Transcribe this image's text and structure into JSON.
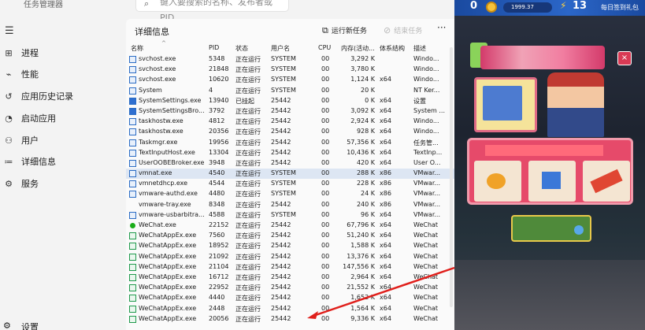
{
  "window": {
    "title": "任务管理器"
  },
  "search": {
    "placeholder": "键入要搜索的名称、发布者或 PID"
  },
  "sidebar": {
    "items": [
      {
        "label": "进程",
        "icon": "grid-icon"
      },
      {
        "label": "性能",
        "icon": "chart-icon"
      },
      {
        "label": "应用历史记录",
        "icon": "history-icon"
      },
      {
        "label": "启动应用",
        "icon": "gauge-icon"
      },
      {
        "label": "用户",
        "icon": "users-icon"
      },
      {
        "label": "详细信息",
        "icon": "list-icon",
        "active": true
      },
      {
        "label": "服务",
        "icon": "gear-icon"
      }
    ],
    "settings_label": "设置"
  },
  "panel": {
    "title": "详细信息",
    "run_task": "运行新任务",
    "end_task": "结束任务",
    "more": "···"
  },
  "table": {
    "headers": [
      "名称",
      "PID",
      "状态",
      "用户名",
      "CPU",
      "内存(活动...",
      "体系结构",
      "描述"
    ],
    "rows": [
      {
        "icon": "box",
        "name": "svchost.exe",
        "pid": "5348",
        "status": "正在运行",
        "user": "SYSTEM",
        "cpu": "00",
        "mem": "3,292 K",
        "arch": "",
        "desc": "Windo..."
      },
      {
        "icon": "box",
        "name": "svchost.exe",
        "pid": "21848",
        "status": "正在运行",
        "user": "SYSTEM",
        "cpu": "00",
        "mem": "3,780 K",
        "arch": "",
        "desc": "Windo..."
      },
      {
        "icon": "box",
        "name": "svchost.exe",
        "pid": "10620",
        "status": "正在运行",
        "user": "SYSTEM",
        "cpu": "00",
        "mem": "1,124 K",
        "arch": "x64",
        "desc": "Windo..."
      },
      {
        "icon": "box",
        "name": "System",
        "pid": "4",
        "status": "正在运行",
        "user": "SYSTEM",
        "cpu": "00",
        "mem": "20 K",
        "arch": "",
        "desc": "NT Ker..."
      },
      {
        "icon": "gear",
        "name": "SystemSettings.exe",
        "pid": "13940",
        "status": "已挂起",
        "user": "25442",
        "cpu": "00",
        "mem": "0 K",
        "arch": "x64",
        "desc": "设置"
      },
      {
        "icon": "gear",
        "name": "SystemSettingsBro...",
        "pid": "3792",
        "status": "正在运行",
        "user": "25442",
        "cpu": "00",
        "mem": "3,092 K",
        "arch": "x64",
        "desc": "System ..."
      },
      {
        "icon": "box",
        "name": "taskhostw.exe",
        "pid": "4812",
        "status": "正在运行",
        "user": "25442",
        "cpu": "00",
        "mem": "2,924 K",
        "arch": "x64",
        "desc": "Windo..."
      },
      {
        "icon": "box",
        "name": "taskhostw.exe",
        "pid": "20356",
        "status": "正在运行",
        "user": "25442",
        "cpu": "00",
        "mem": "928 K",
        "arch": "x64",
        "desc": "Windo..."
      },
      {
        "icon": "box",
        "name": "Taskmgr.exe",
        "pid": "19956",
        "status": "正在运行",
        "user": "25442",
        "cpu": "00",
        "mem": "57,356 K",
        "arch": "x64",
        "desc": "任务管..."
      },
      {
        "icon": "box",
        "name": "TextInputHost.exe",
        "pid": "13304",
        "status": "正在运行",
        "user": "25442",
        "cpu": "00",
        "mem": "10,436 K",
        "arch": "x64",
        "desc": "TextInp..."
      },
      {
        "icon": "box",
        "name": "UserOOBEBroker.exe",
        "pid": "3948",
        "status": "正在运行",
        "user": "25442",
        "cpu": "00",
        "mem": "420 K",
        "arch": "x64",
        "desc": "User O..."
      },
      {
        "icon": "box",
        "name": "vmnat.exe",
        "pid": "4540",
        "status": "正在运行",
        "user": "SYSTEM",
        "cpu": "00",
        "mem": "288 K",
        "arch": "x86",
        "desc": "VMwar...",
        "selected": true
      },
      {
        "icon": "box",
        "name": "vmnetdhcp.exe",
        "pid": "4544",
        "status": "正在运行",
        "user": "SYSTEM",
        "cpu": "00",
        "mem": "228 K",
        "arch": "x86",
        "desc": "VMwar..."
      },
      {
        "icon": "box",
        "name": "vmware-authd.exe",
        "pid": "4480",
        "status": "正在运行",
        "user": "SYSTEM",
        "cpu": "00",
        "mem": "24 K",
        "arch": "x86",
        "desc": "VMwar..."
      },
      {
        "icon": "none",
        "name": "vmware-tray.exe",
        "pid": "8348",
        "status": "正在运行",
        "user": "25442",
        "cpu": "00",
        "mem": "240 K",
        "arch": "x86",
        "desc": "VMwar..."
      },
      {
        "icon": "box",
        "name": "vmware-usbarbitra...",
        "pid": "4588",
        "status": "正在运行",
        "user": "SYSTEM",
        "cpu": "00",
        "mem": "96 K",
        "arch": "x64",
        "desc": "VMwar..."
      },
      {
        "icon": "wechat",
        "name": "WeChat.exe",
        "pid": "22152",
        "status": "正在运行",
        "user": "25442",
        "cpu": "00",
        "mem": "67,796 K",
        "arch": "x64",
        "desc": "WeChat"
      },
      {
        "icon": "app",
        "name": "WeChatAppEx.exe",
        "pid": "7560",
        "status": "正在运行",
        "user": "25442",
        "cpu": "00",
        "mem": "51,240 K",
        "arch": "x64",
        "desc": "WeChat"
      },
      {
        "icon": "app",
        "name": "WeChatAppEx.exe",
        "pid": "18952",
        "status": "正在运行",
        "user": "25442",
        "cpu": "00",
        "mem": "1,588 K",
        "arch": "x64",
        "desc": "WeChat"
      },
      {
        "icon": "app",
        "name": "WeChatAppEx.exe",
        "pid": "21092",
        "status": "正在运行",
        "user": "25442",
        "cpu": "00",
        "mem": "13,376 K",
        "arch": "x64",
        "desc": "WeChat"
      },
      {
        "icon": "app",
        "name": "WeChatAppEx.exe",
        "pid": "21104",
        "status": "正在运行",
        "user": "25442",
        "cpu": "00",
        "mem": "147,556 K",
        "arch": "x64",
        "desc": "WeChat"
      },
      {
        "icon": "app",
        "name": "WeChatAppEx.exe",
        "pid": "16712",
        "status": "正在运行",
        "user": "25442",
        "cpu": "00",
        "mem": "2,964 K",
        "arch": "x64",
        "desc": "WeChat"
      },
      {
        "icon": "app",
        "name": "WeChatAppEx.exe",
        "pid": "22952",
        "status": "正在运行",
        "user": "25442",
        "cpu": "00",
        "mem": "21,552 K",
        "arch": "x64",
        "desc": "WeChat"
      },
      {
        "icon": "app",
        "name": "WeChatAppEx.exe",
        "pid": "4440",
        "status": "正在运行",
        "user": "25442",
        "cpu": "00",
        "mem": "1,652 K",
        "arch": "x64",
        "desc": "WeChat"
      },
      {
        "icon": "app",
        "name": "WeChatAppEx.exe",
        "pid": "2448",
        "status": "正在运行",
        "user": "25442",
        "cpu": "00",
        "mem": "1,564 K",
        "arch": "x64",
        "desc": "WeChat"
      },
      {
        "icon": "app",
        "name": "WeChatAppEx.exe",
        "pid": "20056",
        "status": "正在运行",
        "user": "25442",
        "cpu": "00",
        "mem": "9,336 K",
        "arch": "x64",
        "desc": "WeChat"
      }
    ]
  },
  "game": {
    "score": "0",
    "coin_count": "1999.37",
    "level": "13",
    "daily_sign": "每日签到礼包",
    "close": "×"
  },
  "colors": {
    "accent": "#2b6cc4",
    "selected_row": "#dde6f3",
    "annotation_arrow": "#e0201c"
  }
}
